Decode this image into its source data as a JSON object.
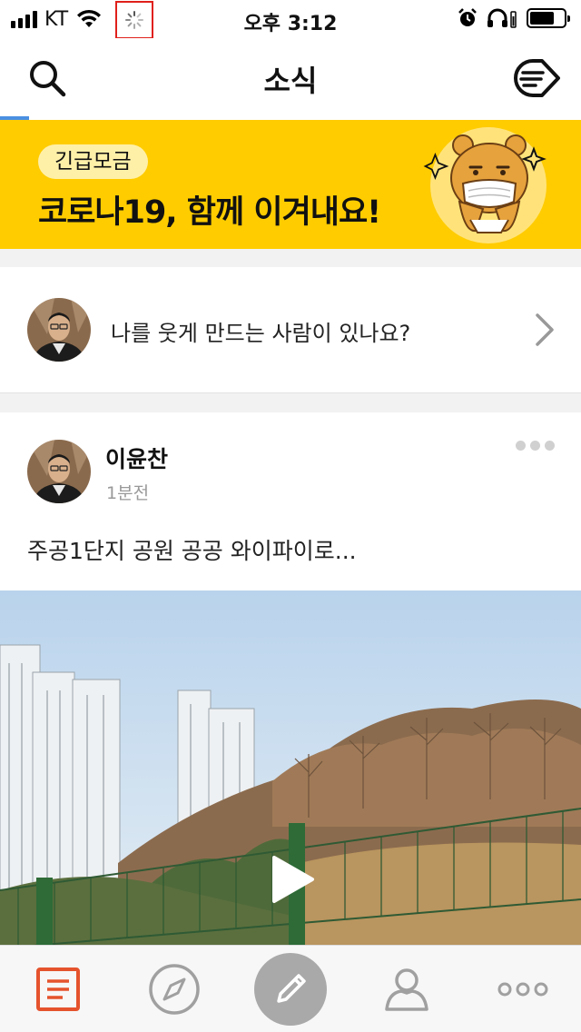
{
  "status_bar": {
    "carrier": "KT",
    "time": "오후 3:12"
  },
  "header": {
    "title": "소식",
    "loading_progress": 0.05
  },
  "banner": {
    "tag": "긴급모금",
    "title": "코로나19, 함께 이겨내요!",
    "background_color": "#ffcc00"
  },
  "question": {
    "text": "나를 웃게 만드는 사람이 있나요?"
  },
  "post": {
    "author": "이윤찬",
    "time": "1분전",
    "text": "주공1단지 공원 공공 와이파이로..."
  },
  "tab_bar": {
    "active_tab": "news",
    "accent_color": "#e5532d",
    "items": [
      {
        "id": "news",
        "icon": "news-feed-icon"
      },
      {
        "id": "explore",
        "icon": "compass-icon"
      },
      {
        "id": "write",
        "icon": "pencil-icon"
      },
      {
        "id": "profile",
        "icon": "person-icon"
      },
      {
        "id": "more",
        "icon": "more-dots-icon"
      }
    ]
  }
}
